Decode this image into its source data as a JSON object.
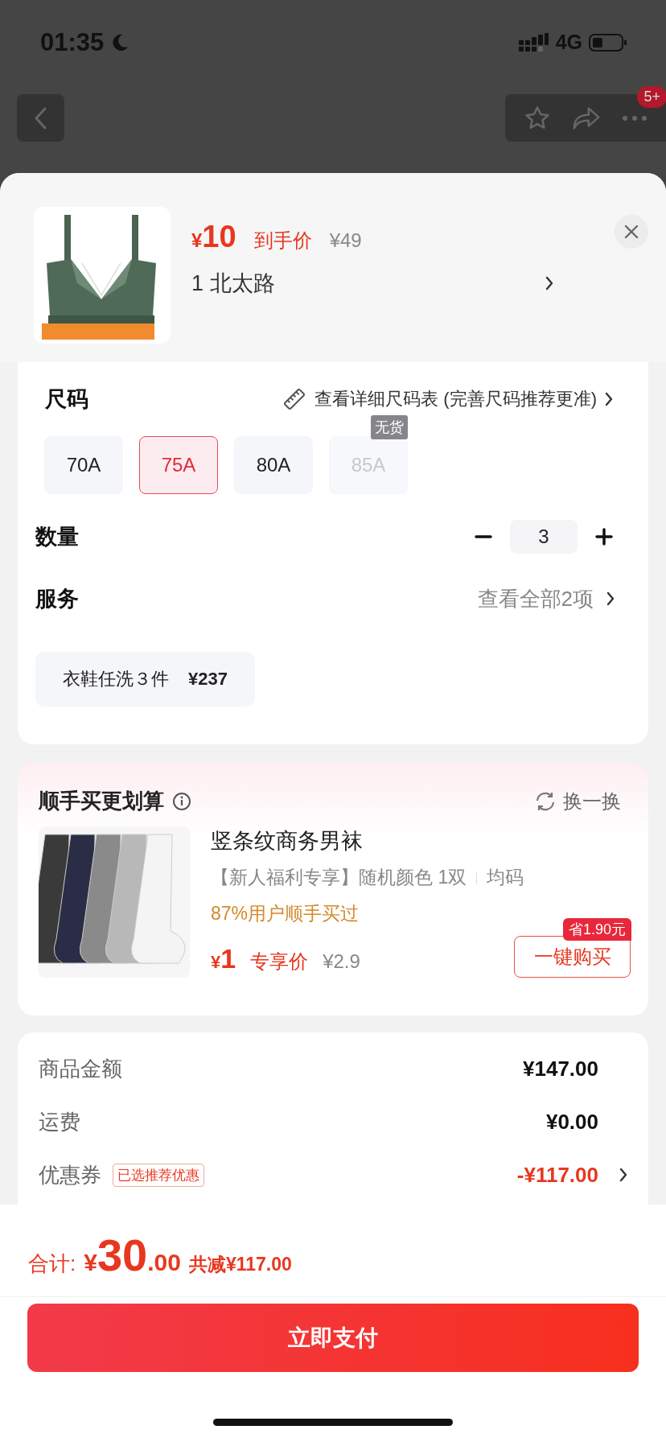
{
  "status_bar": {
    "time": "01:35",
    "network": "4G"
  },
  "nav": {
    "badge": "5+"
  },
  "product": {
    "currency": "¥",
    "price": "10",
    "price_label": "到手价",
    "original_price": "¥49",
    "variant": "1  北太路"
  },
  "size": {
    "title": "尺码",
    "guide_link": "查看详细尺码表 (完善尺码推荐更准)",
    "options": [
      {
        "label": "70A",
        "selected": false,
        "disabled": false
      },
      {
        "label": "75A",
        "selected": true,
        "disabled": false
      },
      {
        "label": "80A",
        "selected": false,
        "disabled": false
      },
      {
        "label": "85A",
        "selected": false,
        "disabled": true,
        "tag": "无货"
      }
    ]
  },
  "quantity": {
    "label": "数量",
    "value": "3"
  },
  "service": {
    "label": "服务",
    "link": "查看全部2项",
    "chips": [
      {
        "name": "衣鞋任洗３件",
        "price": "¥237"
      }
    ]
  },
  "upsell": {
    "title": "顺手买更划算",
    "refresh": "换一换",
    "item": {
      "name": "竖条纹商务男袜",
      "desc": "【新人福利专享】随机颜色 1双",
      "spec": "均码",
      "social": "87%用户顺手买过",
      "currency": "¥",
      "price": "1",
      "price_label": "专享价",
      "original_price": "¥2.9",
      "save_badge": "省1.90元",
      "buy": "一键购买"
    }
  },
  "summary": [
    {
      "kind": "plain",
      "label": "商品金额",
      "value": "¥147.00"
    },
    {
      "kind": "plain",
      "label": "运费",
      "value": "¥0.00"
    },
    {
      "kind": "coupon",
      "label": "优惠券",
      "tag": "已选推荐优惠",
      "value": "-¥117.00"
    }
  ],
  "footer": {
    "total_label": "合计:",
    "currency": "¥",
    "integer": "30",
    "decimals": ".00",
    "reduction": "共减¥117.00",
    "pay": "立即支付"
  }
}
